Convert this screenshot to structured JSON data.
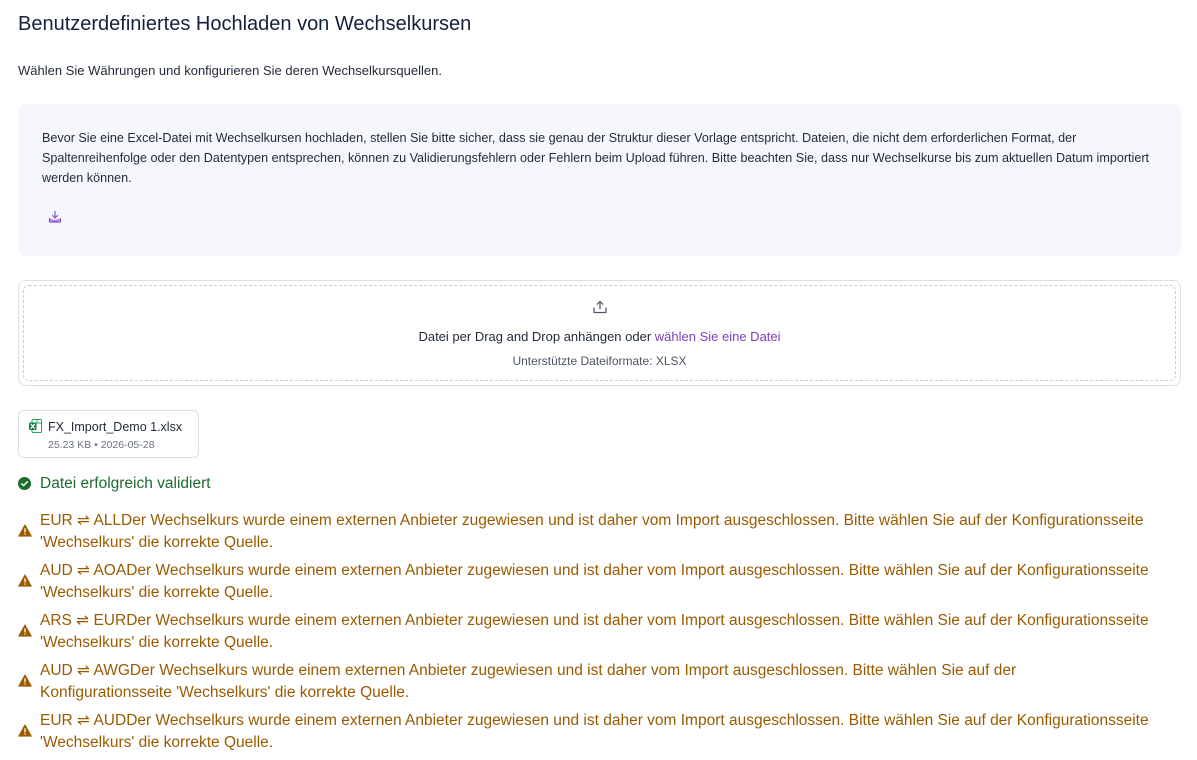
{
  "header": {
    "title": "Benutzerdefiniertes Hochladen von Wechselkursen",
    "subtitle": "Wählen Sie Währungen und konfigurieren Sie deren Wechselkursquellen."
  },
  "info": {
    "text": "Bevor Sie eine Excel-Datei mit Wechselkursen hochladen, stellen Sie bitte sicher, dass sie genau der Struktur dieser Vorlage entspricht. Dateien, die nicht dem erforderlichen Format, der Spaltenreihenfolge oder den Datentypen entsprechen, können zu Validierungsfehlern oder Fehlern beim Upload führen. Bitte beachten Sie, dass nur Wechselkurse bis zum aktuellen Datum importiert werden können.",
    "download_icon": "download-icon"
  },
  "dropzone": {
    "upload_icon": "upload-icon",
    "prompt": "Datei per Drag and Drop anhängen oder ",
    "link": "wählen Sie eine Datei",
    "formats": "Unterstützte Dateiformate: XLSX"
  },
  "file": {
    "icon": "excel-file-icon",
    "name": "FX_Import_Demo 1.xlsx",
    "meta": "25.23 KB • 2026-05-28"
  },
  "status": {
    "icon": "check-circle-icon",
    "text": "Datei erfolgreich validiert"
  },
  "warnings": [
    {
      "icon": "warning-icon",
      "text": "EUR ⇌ ALLDer Wechselkurs wurde einem externen Anbieter zugewiesen und ist daher vom Import ausgeschlossen. Bitte wählen Sie auf der Konfigurationsseite 'Wechselkurs' die korrekte Quelle."
    },
    {
      "icon": "warning-icon",
      "text": "AUD ⇌ AOADer Wechselkurs wurde einem externen Anbieter zugewiesen und ist daher vom Import ausgeschlossen. Bitte wählen Sie auf der Konfigurationsseite 'Wechselkurs' die korrekte Quelle."
    },
    {
      "icon": "warning-icon",
      "text": "ARS ⇌ EURDer Wechselkurs wurde einem externen Anbieter zugewiesen und ist daher vom Import ausgeschlossen. Bitte wählen Sie auf der Konfigurationsseite 'Wechselkurs' die korrekte Quelle."
    },
    {
      "icon": "warning-icon",
      "text": "AUD ⇌ AWGDer Wechselkurs wurde einem externen Anbieter zugewiesen und ist daher vom Import ausgeschlossen. Bitte wählen Sie auf der Konfigurationsseite 'Wechselkurs' die korrekte Quelle."
    },
    {
      "icon": "warning-icon",
      "text": "EUR ⇌ AUDDer Wechselkurs wurde einem externen Anbieter zugewiesen und ist daher vom Import ausgeschlossen. Bitte wählen Sie auf der Konfigurationsseite 'Wechselkurs' die korrekte Quelle."
    }
  ],
  "colors": {
    "accent": "#7b3fbf",
    "success": "#1e6b30",
    "warning": "#9a5a00",
    "info_background": "#f5f7fc"
  }
}
